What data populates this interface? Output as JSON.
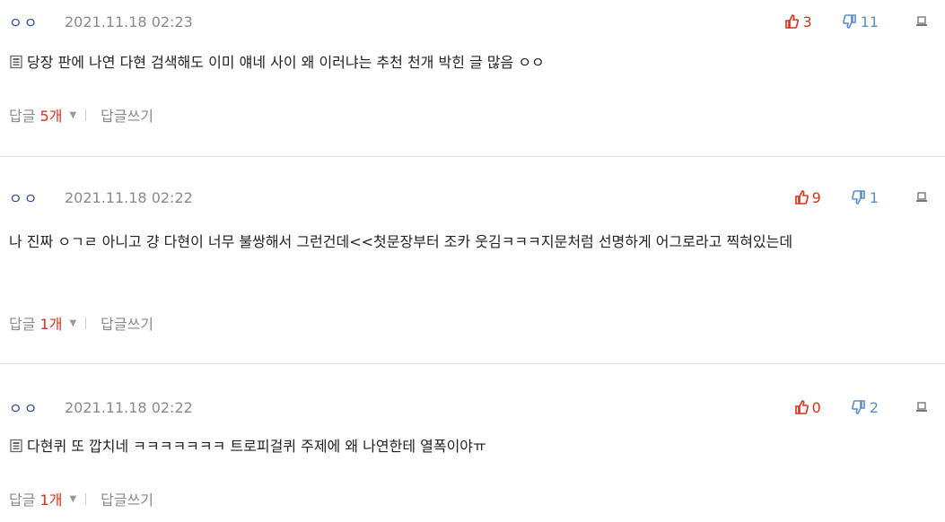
{
  "comments": [
    {
      "nick": "ㅇㅇ",
      "date": "2021.11.18 02:23",
      "likes": "3",
      "dislikes": "11",
      "has_image": true,
      "text": "당장 판에 나연 다현 검색해도 이미 얘네 사이 왜 이러냐는 추천 천개 박힌 글 많음 ㅇㅇ",
      "reply_label": "답글 ",
      "reply_count": "5개",
      "write_reply": "답글쓰기"
    },
    {
      "nick": "ㅇㅇ",
      "date": "2021.11.18 02:22",
      "likes": "9",
      "dislikes": "1",
      "has_image": false,
      "text": "나 진짜 ㅇㄱㄹ 아니고 걍 다현이 너무 불쌍해서 그런건데<<첫문장부터 조카 웃김ㅋㅋㅋ지문처럼 선명하게 어그로라고 찍혀있는데",
      "reply_label": "답글 ",
      "reply_count": "1개",
      "write_reply": "답글쓰기"
    },
    {
      "nick": "ㅇㅇ",
      "date": "2021.11.18 02:22",
      "likes": "0",
      "dislikes": "2",
      "has_image": true,
      "text": "다현퀴 또 깝치네 ㅋㅋㅋㅋㅋㅋㅋ 트로피걸퀴 주제에 왜 나연한테 열폭이야ㅠ",
      "reply_label": "답글 ",
      "reply_count": "1개",
      "write_reply": "답글쓰기"
    }
  ],
  "colors": {
    "like": "#d8301a",
    "dislike": "#5b8ec6",
    "nick": "#2c4a9c",
    "meta": "#8a8a8a"
  },
  "icons": {
    "like": "thumbs-up-icon",
    "dislike": "thumbs-down-icon",
    "report": "report-icon",
    "image": "image-attachment-icon",
    "caret": "caret-down-icon"
  }
}
